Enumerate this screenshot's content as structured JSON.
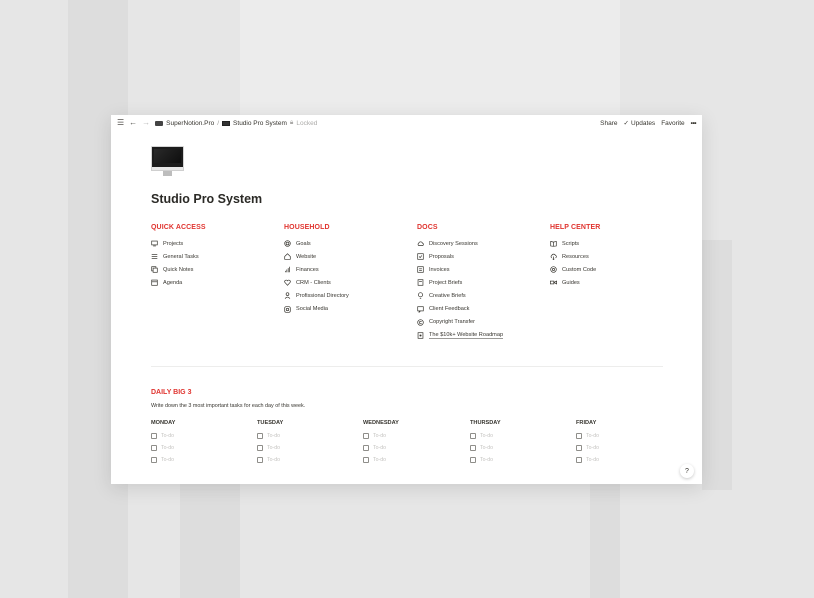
{
  "topbar": {
    "workspace": "SuperNotion.Pro",
    "page": "Studio Pro System",
    "locked": "Locked",
    "share": "Share",
    "updates": "Updates",
    "favorite": "Favorite",
    "more": "•••"
  },
  "page": {
    "title": "Studio Pro System"
  },
  "sections": [
    {
      "title": "QUICK ACCESS",
      "items": [
        {
          "label": "Projects",
          "icon": "monitor-icon"
        },
        {
          "label": "General Tasks",
          "icon": "list-icon"
        },
        {
          "label": "Quick Notes",
          "icon": "notes-icon"
        },
        {
          "label": "Agenda",
          "icon": "calendar-icon"
        }
      ]
    },
    {
      "title": "HOUSEHOLD",
      "items": [
        {
          "label": "Goals",
          "icon": "target-icon"
        },
        {
          "label": "Website",
          "icon": "home-icon"
        },
        {
          "label": "Finances",
          "icon": "bars-icon"
        },
        {
          "label": "CRM - Clients",
          "icon": "heart-icon"
        },
        {
          "label": "Profissional Directory",
          "icon": "person-icon"
        },
        {
          "label": "Social Media",
          "icon": "instagram-icon"
        }
      ]
    },
    {
      "title": "DOCS",
      "items": [
        {
          "label": "Discovery Sessions",
          "icon": "cloud-icon"
        },
        {
          "label": "Proposals",
          "icon": "check-square-icon"
        },
        {
          "label": "Invoices",
          "icon": "invoice-icon"
        },
        {
          "label": "Project Briefs",
          "icon": "brief-icon"
        },
        {
          "label": "Creative Briefs",
          "icon": "bulb-icon"
        },
        {
          "label": "Client Feedback",
          "icon": "feedback-icon"
        },
        {
          "label": "Copyright Transfer",
          "icon": "copyright-icon"
        },
        {
          "label": "The $10k+ Website Roadmap",
          "icon": "roadmap-icon"
        }
      ]
    },
    {
      "title": "HELP CENTER",
      "items": [
        {
          "label": "Scripts",
          "icon": "book-icon"
        },
        {
          "label": "Resources",
          "icon": "cloud-download-icon"
        },
        {
          "label": "Custom Code",
          "icon": "code-icon"
        },
        {
          "label": "Guides",
          "icon": "guides-icon"
        }
      ]
    }
  ],
  "daily": {
    "title": "DAILY BIG 3",
    "description": "Write down the 3 most important tasks for each day of this week.",
    "todo_placeholder": "To-do",
    "days": [
      "MONDAY",
      "TUESDAY",
      "WEDNESDAY",
      "THURSDAY",
      "FRIDAY"
    ]
  },
  "help": {
    "label": "?"
  }
}
